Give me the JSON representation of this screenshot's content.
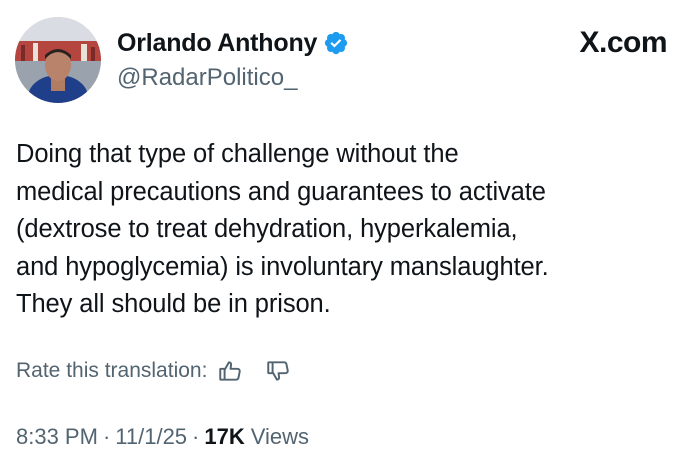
{
  "author": {
    "display_name": "Orlando Anthony",
    "handle": "@RadarPolitico_",
    "verified": true
  },
  "brand": {
    "label": "X.com"
  },
  "tweet": {
    "lines": [
      "Doing that type of challenge without the",
      "medical precautions and guarantees to activate",
      "(dextrose to treat dehydration, hyperkalemia,",
      "and hypoglycemia) is involuntary manslaughter.",
      "They all should be in prison."
    ]
  },
  "translation": {
    "rate_label": "Rate this translation:",
    "like_icon": "thumbs-up-icon",
    "dislike_icon": "thumbs-down-icon"
  },
  "meta": {
    "time": "8:33 PM",
    "separator": "·",
    "date": "11/1/25",
    "views_count": "17K",
    "views_label": "Views"
  },
  "colors": {
    "text_primary": "#0f1419",
    "text_secondary": "#536471",
    "verified_badge": "#1d9bf0"
  }
}
